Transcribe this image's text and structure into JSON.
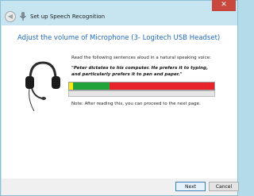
{
  "window": {
    "title": "Set up Speech Recognition",
    "close_glyph": "✕",
    "back_glyph": "◀"
  },
  "page": {
    "heading": "Adjust the volume of Microphone (3- Logitech USB Headset)",
    "instruction": "Read the following sentences aloud in a natural speaking voice:",
    "sentence": "\"Peter dictates to his computer. He prefers it to typing, and particularly prefers it to pen and paper.\"",
    "note": "Note: After reading this, you can proceed to the next page."
  },
  "volume_meter": {
    "zones": [
      "yellow",
      "green",
      "red"
    ],
    "colors": {
      "yellow": "#f7ea14",
      "green": "#22a33a",
      "red": "#e8232b"
    }
  },
  "level_progress": {
    "value": 0
  },
  "footer": {
    "next_label": "Next",
    "cancel_label": "Cancel"
  },
  "icons": {
    "back": "back-arrow-icon",
    "title_icon": "microphone-icon",
    "illustration": "headset-icon"
  }
}
